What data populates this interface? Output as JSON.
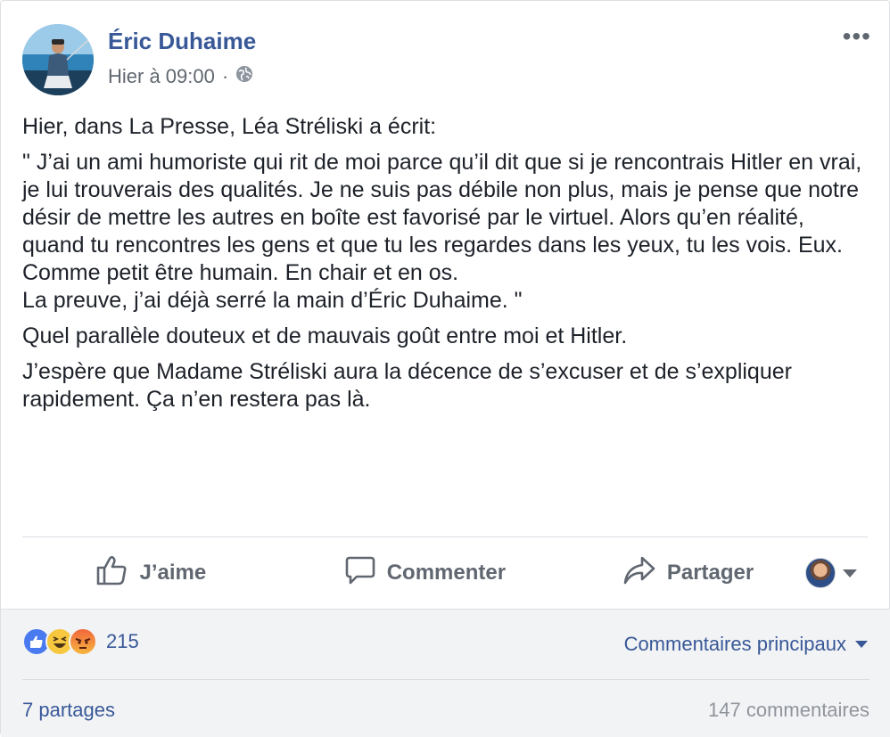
{
  "post": {
    "author": "Éric Duhaime",
    "timestamp": "Hier à 09:00",
    "separator": "·",
    "privacy_icon": "globe-icon",
    "more_label": "•••",
    "paragraphs": [
      "Hier, dans La Presse, Léa Stréliski a écrit:",
      "\" J’ai un ami humoriste qui rit de moi parce qu’il dit que si je rencontrais Hitler en vrai, je lui trouverais des qualités. Je ne suis pas débile non plus, mais je pense que notre désir de mettre les autres en boîte est favorisé par le virtuel. Alors qu’en réalité, quand tu rencontres les gens et que tu les regardes dans les yeux, tu les vois. Eux. Comme petit être humain. En chair et en os.\nLa preuve, j’ai déjà serré la main d’Éric Duhaime. \"",
      "Quel parallèle douteux et de mauvais goût entre moi et Hitler.",
      "J’espère que Madame Stréliski aura la décence de s’excuser et de s’expliquer rapidement. Ça n’en restera pas là."
    ]
  },
  "actions": {
    "like_label": "J’aime",
    "comment_label": "Commenter",
    "share_label": "Partager"
  },
  "footer": {
    "reaction_count": "215",
    "reactions": [
      "like",
      "haha",
      "angry"
    ],
    "sort_label": "Commentaires principaux",
    "shares_label": "7 partages",
    "comments_label": "147 commentaires"
  },
  "colors": {
    "link_blue": "#385898",
    "muted_gray": "#606770",
    "footer_bg": "#f2f3f5",
    "like_blue": "#4a7af0"
  }
}
